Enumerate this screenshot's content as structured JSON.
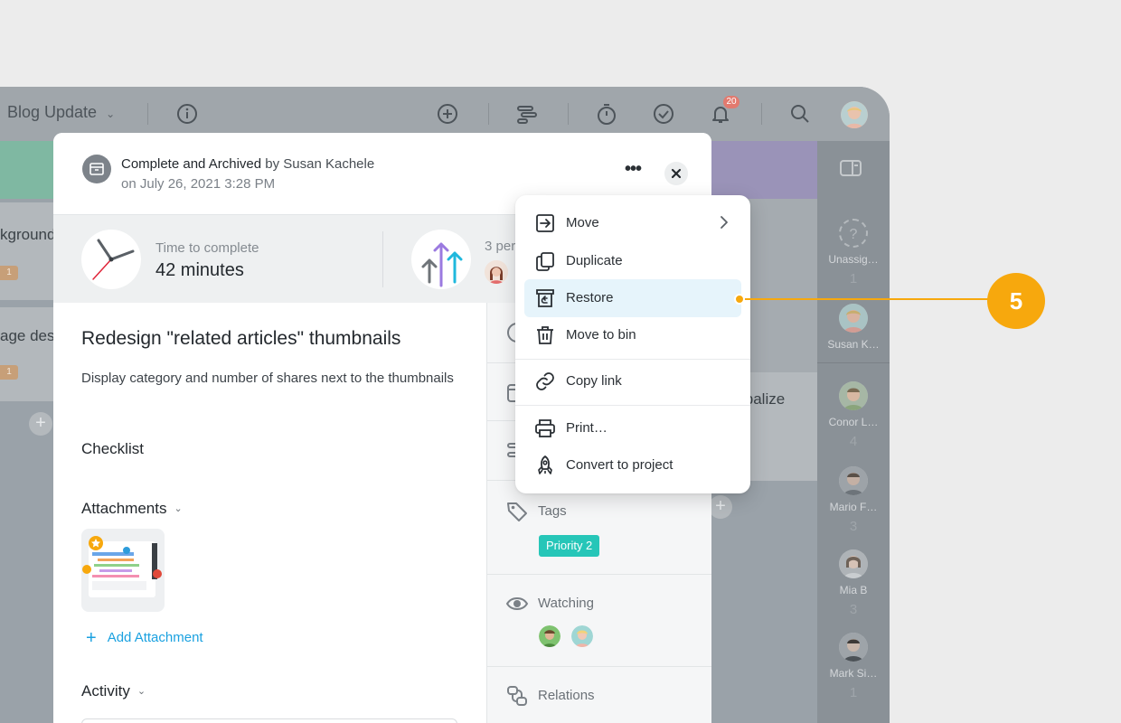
{
  "app": {
    "project_name": "Blog Update",
    "notification_count": "20",
    "board": {
      "left_cards": [
        {
          "text": "kground",
          "chip": "1"
        },
        {
          "text": "age des",
          "chip": "1"
        }
      ],
      "right_card_text": "ibalize",
      "plus_symbol": "+"
    },
    "people": [
      {
        "name": "Unassig…",
        "count": "1"
      },
      {
        "name": "Susan K…",
        "count": ""
      },
      {
        "name": "Conor L…",
        "count": "4"
      },
      {
        "name": "Mario F…",
        "count": "3"
      },
      {
        "name": "Mia B",
        "count": "3"
      },
      {
        "name": "Mark Si…",
        "count": "1"
      }
    ]
  },
  "task": {
    "status_bold": "Complete and Archived",
    "status_by": "by Susan Kachele",
    "status_date": "on July 26, 2021 3:28 PM",
    "more_symbol": "•••",
    "time_label": "Time to complete",
    "time_value": "42 minutes",
    "persons_label": "3 per",
    "title": "Redesign \"related articles\" thumbnails",
    "description": "Display category and number of shares next to the thumbnails",
    "checklist_heading": "Checklist",
    "attachments_heading": "Attachments",
    "add_attachment": "Add Attachment",
    "activity_heading": "Activity",
    "side": {
      "tags_label": "Tags",
      "tag": "Priority 2",
      "watching_label": "Watching",
      "relations_label": "Relations"
    }
  },
  "menu": {
    "items": [
      {
        "label": "Move",
        "icon": "move-icon"
      },
      {
        "label": "Duplicate",
        "icon": "duplicate-icon"
      },
      {
        "label": "Restore",
        "icon": "restore-icon"
      },
      {
        "label": "Move to bin",
        "icon": "trash-icon"
      },
      {
        "label": "Copy link",
        "icon": "link-icon"
      },
      {
        "label": "Print…",
        "icon": "print-icon"
      },
      {
        "label": "Convert to project",
        "icon": "rocket-icon"
      }
    ]
  },
  "callout": {
    "number": "5",
    "color": "#f7a80d"
  }
}
